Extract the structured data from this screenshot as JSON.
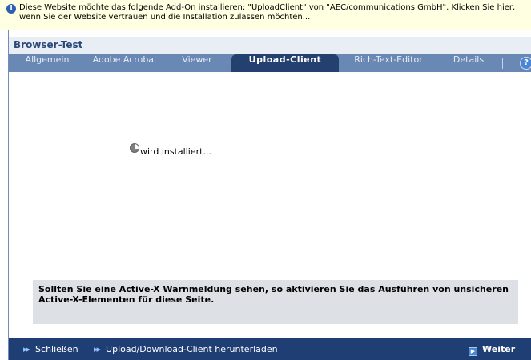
{
  "infobar": {
    "icon": "shield-info-icon",
    "text": "Diese Website möchte das folgende Add-On installieren: \"UploadClient\" von \"AEC/communications GmbH\". Klicken Sie hier, wenn Sie der Website vertrauen und die Installation zulassen möchten..."
  },
  "window": {
    "title": "Browser-Test"
  },
  "tabs": [
    {
      "label": "Allgemein",
      "active": false
    },
    {
      "label": "Adobe Acrobat",
      "active": false
    },
    {
      "label": "Viewer",
      "active": false
    },
    {
      "label": "Upload-Client",
      "active": true
    },
    {
      "label": "Rich-Text-Editor",
      "active": false
    },
    {
      "label": "Details",
      "active": false
    }
  ],
  "help": {
    "icon": "help-icon",
    "glyph": "?"
  },
  "main": {
    "status_icon": "spinner-icon",
    "status_text": "wird installiert..."
  },
  "notice": {
    "text": "Sollten Sie eine Active-X Warnmeldung sehen, so aktivieren Sie das Ausführen von unsicheren Active-X-Elementen für diese Seite."
  },
  "footer": {
    "close_label": "Schließen",
    "download_label": "Upload/Download-Client herunterladen",
    "next_label": "Weiter",
    "arrow_glyph": "▸▸",
    "next_glyph": "▶"
  },
  "colors": {
    "infobar_bg": "#ffffe1",
    "tabbar_bg": "#6a88b4",
    "active_tab_bg": "#23406f",
    "footer_bg": "#1f3f74",
    "notice_bg": "#dde0e5"
  }
}
